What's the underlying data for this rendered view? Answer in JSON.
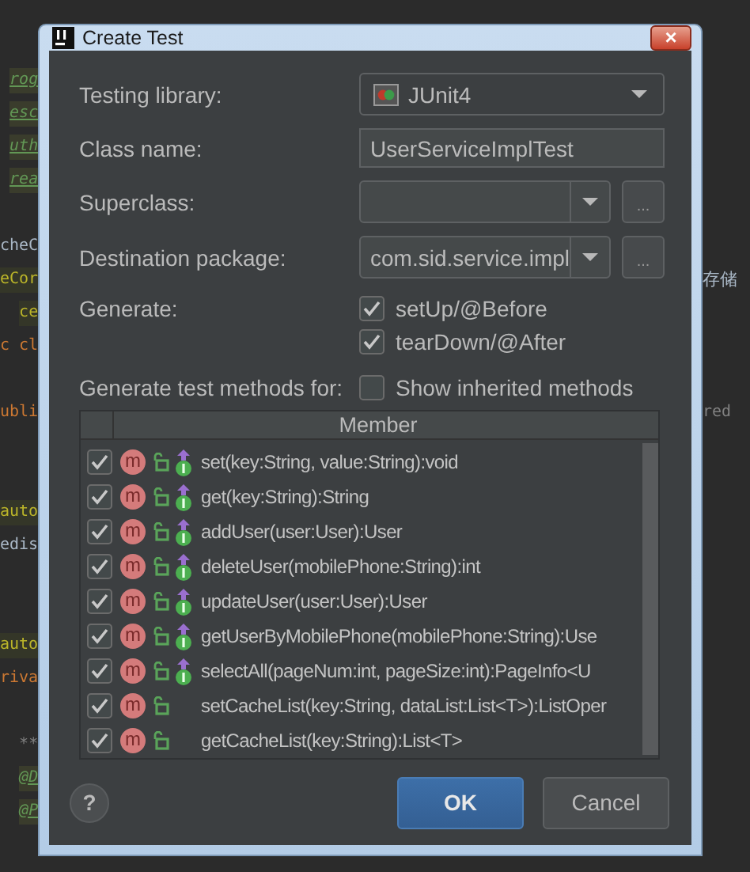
{
  "editor": {
    "left_lines": [
      {
        "text": "rog",
        "kind": "doc"
      },
      {
        "text": "esc",
        "kind": "doc"
      },
      {
        "text": "uth",
        "kind": "doc"
      },
      {
        "text": "rea",
        "kind": "doc"
      },
      {
        "text": "cheC",
        "kind": "code"
      },
      {
        "text": "eCor",
        "kind": "annotation"
      },
      {
        "text": "ce",
        "kind": "annotation"
      },
      {
        "text": "c cl",
        "kind": "keyword"
      },
      {
        "text": "ubli",
        "kind": "keyword"
      },
      {
        "text": "auto",
        "kind": "annotation"
      },
      {
        "text": "edis",
        "kind": "code"
      },
      {
        "text": "auto",
        "kind": "annotation"
      },
      {
        "text": "riva",
        "kind": "keyword"
      },
      {
        "text": "**",
        "kind": "comment"
      },
      {
        "text": "@D",
        "kind": "doc"
      },
      {
        "text": "@P",
        "kind": "doc"
      }
    ],
    "right_lines": [
      {
        "text": "存储",
        "kind": "code"
      },
      {
        "text": "red",
        "kind": "comment"
      }
    ]
  },
  "window": {
    "title": "Create Test",
    "close": "×"
  },
  "form": {
    "testing_library": {
      "label": "Testing library:",
      "value": "JUnit4"
    },
    "class_name": {
      "label": "Class name:",
      "value": "UserServiceImplTest"
    },
    "superclass": {
      "label": "Superclass:",
      "browse": "..."
    },
    "destination_package": {
      "label": "Destination package:",
      "value": "com.sid.service.impl",
      "browse": "..."
    },
    "generate": {
      "label": "Generate:",
      "options": [
        {
          "label": "setUp/@Before",
          "checked": true
        },
        {
          "label": "tearDown/@After",
          "checked": true
        }
      ]
    },
    "methods_for": {
      "label": "Generate test methods for:",
      "show_inherited": {
        "label": "Show inherited methods",
        "checked": false
      }
    }
  },
  "members": {
    "column": "Member",
    "rows": [
      {
        "checked": true,
        "badge": "m",
        "implements": true,
        "signature": "set(key:String, value:String):void"
      },
      {
        "checked": true,
        "badge": "m",
        "implements": true,
        "signature": "get(key:String):String"
      },
      {
        "checked": true,
        "badge": "m",
        "implements": true,
        "signature": "addUser(user:User):User"
      },
      {
        "checked": true,
        "badge": "m",
        "implements": true,
        "signature": "deleteUser(mobilePhone:String):int"
      },
      {
        "checked": true,
        "badge": "m",
        "implements": true,
        "signature": "updateUser(user:User):User"
      },
      {
        "checked": true,
        "badge": "m",
        "implements": true,
        "signature": "getUserByMobilePhone(mobilePhone:String):Use"
      },
      {
        "checked": true,
        "badge": "m",
        "implements": true,
        "signature": "selectAll(pageNum:int, pageSize:int):PageInfo<U"
      },
      {
        "checked": true,
        "badge": "m",
        "implements": false,
        "signature": "setCacheList(key:String, dataList:List<T>):ListOper"
      },
      {
        "checked": true,
        "badge": "m",
        "implements": false,
        "signature": "getCacheList(key:String):List<T>"
      }
    ]
  },
  "buttons": {
    "help": "?",
    "ok": "OK",
    "cancel": "Cancel"
  }
}
